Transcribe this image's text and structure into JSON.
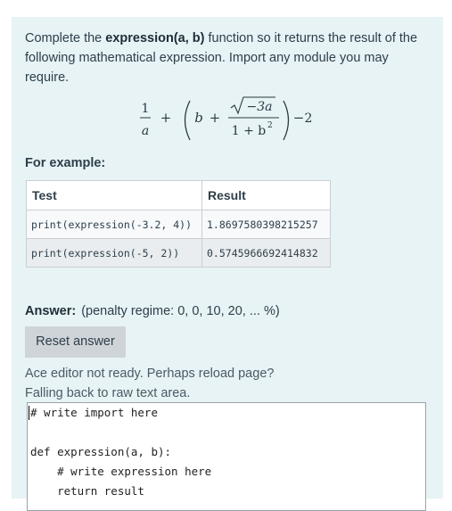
{
  "question": {
    "intro_prefix": "Complete the ",
    "function_name": "expression(a, b)",
    "intro_suffix": " function so it returns the result of the following mathematical expression. Import any module you may require.",
    "formula": {
      "frac1_num": "1",
      "frac1_den": "a",
      "plus1": "+",
      "b": "b",
      "plus2": "+",
      "sqrt_arg": "−3a",
      "den": "1 + b",
      "den_exp": "2",
      "minus": "−",
      "const": "2"
    },
    "for_example_label": "For example:"
  },
  "examples_table": {
    "headers": [
      "Test",
      "Result"
    ],
    "rows": [
      {
        "test": "print(expression(-3.2, 4))",
        "result": "1.8697580398215257"
      },
      {
        "test": "print(expression(-5, 2))",
        "result": "0.5745966692414832"
      }
    ]
  },
  "answer": {
    "label": "Answer:",
    "penalty": "(penalty regime: 0, 0, 10, 20, ... %)",
    "reset_label": "Reset answer",
    "ace_msg_1": "Ace editor not ready. Perhaps reload page?",
    "ace_msg_2": "Falling back to raw text area.",
    "code_lines": [
      "# write import here",
      "",
      "def expression(a, b):",
      "    # write expression here",
      "    return result"
    ]
  }
}
